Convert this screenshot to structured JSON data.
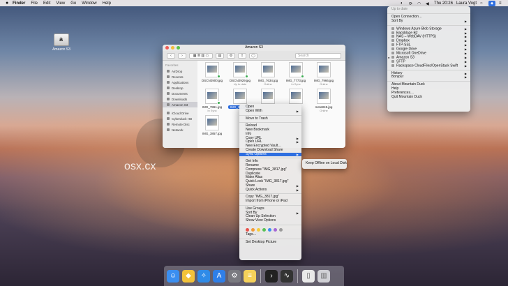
{
  "menubar": {
    "apple": "",
    "items": [
      "Finder",
      "File",
      "Edit",
      "View",
      "Go",
      "Window",
      "Help"
    ],
    "clock": "Thu 20:26",
    "user": "Laura Vogt"
  },
  "desktop_icon": {
    "label": "Amazon S3"
  },
  "finder": {
    "title": "Amazon S3",
    "search_placeholder": "Search",
    "sidebar": {
      "favorites_header": "Favorites",
      "favorites": [
        "AirDrop",
        "Recents",
        "Applications",
        "Desktop",
        "Documents",
        "Downloads",
        "Amazon S3"
      ],
      "locations": [
        "iCloud Drive",
        "Cyberduck HD",
        "Remote Disc",
        "Network"
      ]
    },
    "files": [
      {
        "name": "DSCN2900.jpg",
        "status": ""
      },
      {
        "name": "DSCN2929.jpg",
        "status": "Up to date"
      },
      {
        "name": "IMG_7634.jpg",
        "status": "Online"
      },
      {
        "name": "IMG_7773.jpg",
        "status": "In Sync"
      },
      {
        "name": "IMG_7966.jpg",
        "status": "Online"
      },
      {
        "name": "IMG_7861.jpg",
        "status": "In Sync"
      },
      {
        "name": "IMG_3817.jpg",
        "status": ""
      },
      {
        "name": "",
        "status": ""
      },
      {
        "name": "",
        "status": ""
      },
      {
        "name": "meta045.jpg",
        "status": "Online"
      },
      {
        "name": "IMG_3857.jpg",
        "status": ""
      }
    ]
  },
  "context_menu": {
    "items_1": [
      "Open",
      "Open With"
    ],
    "items_2": [
      "Move to Trash"
    ],
    "items_3": [
      "Reload",
      "New Bookmark",
      "Info",
      "Copy URL",
      "Open URL",
      "New Encrypted Vault…",
      "Create Download Share"
    ],
    "sync_options": "Sync Options",
    "items_4": [
      "Get Info",
      "Rename",
      "Compress \"IMG_3817.jpg\"",
      "Duplicate",
      "Make Alias",
      "Quick Look \"IMG_3817.jpg\""
    ],
    "items_5": [
      "Share",
      "Quick Actions"
    ],
    "items_6": [
      "Copy \"IMG_3817.jpg\"",
      "Import from iPhone or iPad"
    ],
    "items_7": [
      "Use Groups",
      "Sort By",
      "Clean Up Selection",
      "Show View Options"
    ],
    "tags_label": "Tags…",
    "items_8": [
      "Set Desktop Picture"
    ],
    "tag_colors": [
      "#e8524b",
      "#f29b38",
      "#f5cd3a",
      "#57c156",
      "#3c8ef0",
      "#a566d6",
      "#9b9b9b"
    ]
  },
  "submenu": {
    "items": [
      "Keep Offline on Local Disk"
    ]
  },
  "duck_menu": {
    "status": "Up to date",
    "group_1": [
      "Open Connection…",
      "Sort By"
    ],
    "bookmarks": [
      "Windows Azure Blob Storage",
      "Backblaze B2",
      "NAS – WebDAV (HTTPS)",
      "Dropbox",
      "FTP-SSL",
      "Google Drive",
      "Microsoft OneDrive",
      "Amazon S3",
      "SFTP",
      "Rackspace CloudFiles/OpenStack Swift"
    ],
    "group_2": [
      "History",
      "Bonjour"
    ],
    "group_3": [
      "About Mountain Duck",
      "Help",
      "Preferences…",
      "Quit Mountain Duck"
    ]
  },
  "watermark": {
    "site": "osx.cx"
  },
  "dock": {
    "apps": [
      {
        "icon": "finder-icon",
        "color": "#3a8ef0"
      },
      {
        "icon": "mountain-duck-icon",
        "color": "#f2c23a"
      },
      {
        "icon": "safari-icon",
        "color": "#2f8be8"
      },
      {
        "icon": "app-store-icon",
        "color": "#2f7fe8"
      },
      {
        "icon": "system-preferences-icon",
        "color": "#7a7a80"
      },
      {
        "icon": "notes-icon",
        "color": "#f5d15a"
      },
      {
        "icon": "terminal-icon",
        "color": "#222222"
      },
      {
        "icon": "activity-monitor-icon",
        "color": "#333333"
      },
      {
        "icon": "document-icon",
        "color": "#e9e9e9"
      },
      {
        "icon": "trash-icon",
        "color": "#d0d0d5"
      }
    ]
  }
}
